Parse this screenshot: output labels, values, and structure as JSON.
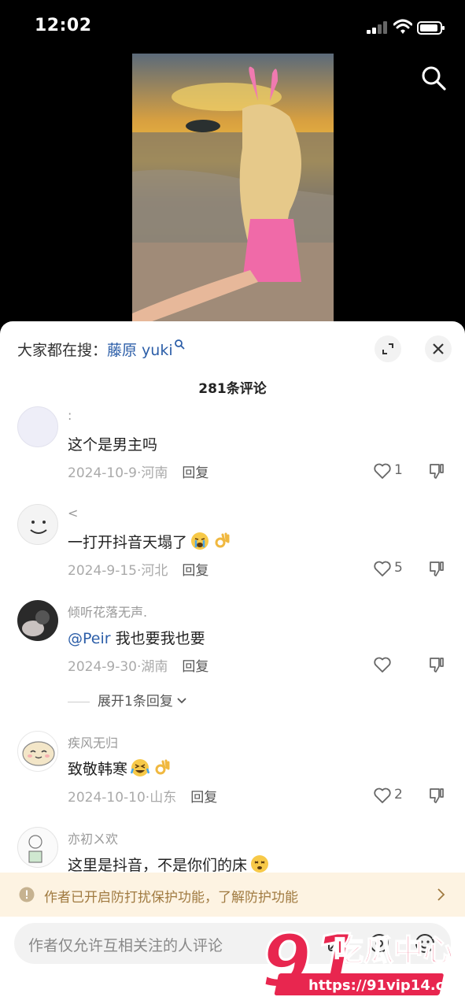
{
  "status_bar": {
    "time": "12:02"
  },
  "hot_search": {
    "prefix": "大家都在搜：",
    "term": "藤原 yuki"
  },
  "comment_count": "281条评论",
  "comments": [
    {
      "name": ":",
      "text": "这个是男主吗",
      "mention": "",
      "emojis": [],
      "date": "2024-10-9",
      "location": "河南",
      "reply_label": "回复",
      "likes": "1"
    },
    {
      "name": "<",
      "text": "一打开抖音天塌了",
      "mention": "",
      "emojis": [
        "crying-face-emoji",
        "ok-hand-emoji"
      ],
      "date": "2024-9-15",
      "location": "河北",
      "reply_label": "回复",
      "likes": "5"
    },
    {
      "name": "倾听花落无声.",
      "text": " 我也要我也要",
      "mention": "@Peir",
      "emojis": [],
      "date": "2024-9-30",
      "location": "湖南",
      "reply_label": "回复",
      "likes": ""
    },
    {
      "name": "疾风无归",
      "text": "致敬韩寒",
      "mention": "",
      "emojis": [
        "rolling-laugh-emoji",
        "ok-hand-emoji"
      ],
      "date": "2024-10-10",
      "location": "山东",
      "reply_label": "回复",
      "likes": "2"
    },
    {
      "name": "亦初ㄨ欢",
      "text": "这里是抖音，不是你们的床",
      "mention": "",
      "emojis": [
        "dizzy-face-emoji"
      ]
    }
  ],
  "expand_replies": "展开1条回复",
  "banner": {
    "text": "作者已开启防打扰保护功能，了解防护功能"
  },
  "input": {
    "placeholder": "作者仅允许互相关注的人评论"
  },
  "watermark": {
    "number": "91",
    "name": "吃瓜中心",
    "url": "https://91vip14.com"
  },
  "colors": {
    "link_blue": "#2c5ea8",
    "banner_bg": "#fdf3e2",
    "banner_text": "#a07a40",
    "watermark_red": "#e8264f"
  }
}
